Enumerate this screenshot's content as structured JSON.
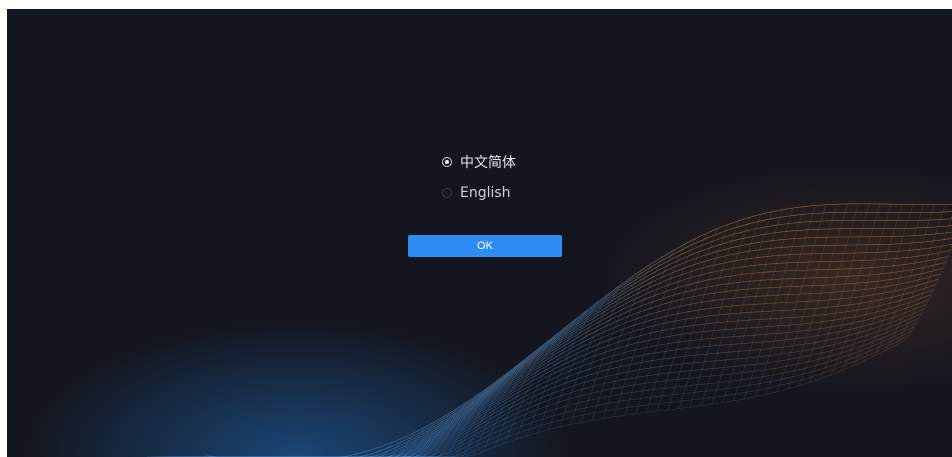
{
  "language_dialog": {
    "options": [
      {
        "label": "中文简体",
        "selected": true
      },
      {
        "label": "English",
        "selected": false
      }
    ],
    "ok_label": "OK"
  },
  "colors": {
    "background": "#14161f",
    "accent": "#2f8cf5",
    "wave_blue": "#4a8fd6",
    "wave_orange": "#d9822b"
  }
}
